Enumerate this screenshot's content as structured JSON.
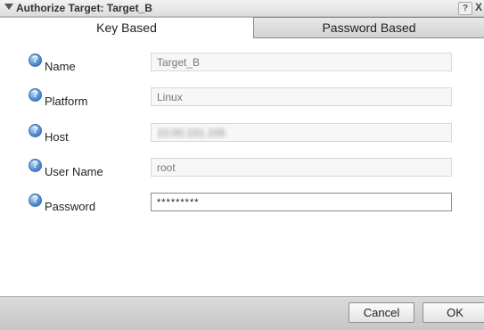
{
  "dialog": {
    "title": "Authorize Target: Target_B",
    "help_label": "?",
    "close_label": "X"
  },
  "tabs": [
    {
      "label": "Key Based",
      "active": true
    },
    {
      "label": "Password Based",
      "active": false
    }
  ],
  "fields": [
    {
      "label": "Name",
      "value": "Target_B",
      "icon": "help-icon"
    },
    {
      "label": "Platform",
      "value": "Linux",
      "icon": "help-icon"
    },
    {
      "label": "Host",
      "value": "10.00.101.105",
      "icon": "help-icon"
    },
    {
      "label": "User Name",
      "value": "root",
      "icon": "help-icon"
    },
    {
      "label": "Password",
      "value": "*********",
      "icon": "help-icon"
    }
  ],
  "footer": {
    "cancel_label": "Cancel",
    "ok_label": "OK"
  }
}
